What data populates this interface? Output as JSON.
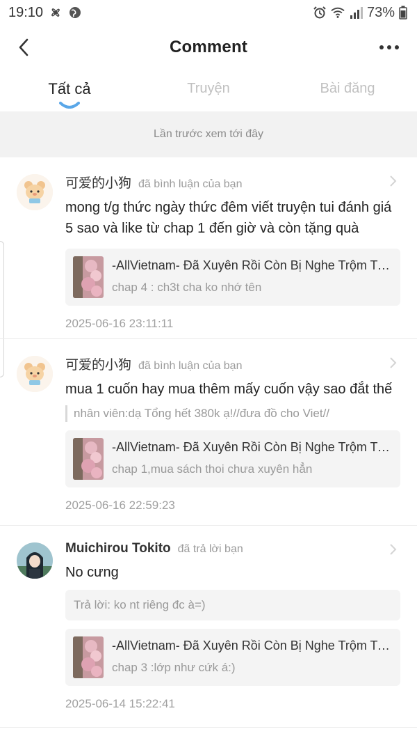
{
  "status_bar": {
    "time": "19:10",
    "battery": "73%"
  },
  "header": {
    "title": "Comment"
  },
  "tabs": [
    {
      "label": "Tất cả",
      "active": true
    },
    {
      "label": "Truyện",
      "active": false
    },
    {
      "label": "Bài đăng",
      "active": false
    }
  ],
  "history_notice": "Lần trước xem tới đây",
  "colors": {
    "accent": "#5aa7e8",
    "background": "#ffffff",
    "muted": "#9a9a9a",
    "card": "#f4f4f4"
  },
  "feed": [
    {
      "user": "可爱的小狗",
      "action": "đã bình luận của bạn",
      "comment": "mong t/g thức ngày thức đêm viết truyện tui đánh giá 5 sao và like từ chap 1 đến giờ và còn tặng quà",
      "ref_title": "-AllVietnam- Đã Xuyên Rồi Còn Bị Nghe Trộm Tiếng Lòng",
      "ref_sub": "chap 4 : ch3t cha ko nhớ tên",
      "time": "2025-06-16 23:11:11"
    },
    {
      "user": "可爱的小狗",
      "action": "đã bình luận của bạn",
      "comment": "mua 1 cuốn hay mua thêm mấy cuốn vậy sao đắt thế",
      "quote": "nhân viên:dạ Tổng hết 380k ạ!//đưa đồ cho Viet//",
      "ref_title": "-AllVietnam- Đã Xuyên Rồi Còn Bị Nghe Trộm Tiếng Lòng",
      "ref_sub": "chap 1,mua sách thoi chưa xuyên hẳn",
      "time": "2025-06-16 22:59:23"
    },
    {
      "user": "Muichirou Tokito",
      "action": "đã trả lời bạn",
      "comment": "No cưng",
      "reply": "Trả lời: ko nt riêng đc à=)",
      "ref_title": "-AllVietnam- Đã Xuyên Rồi Còn Bị Nghe Trộm Tiếng Lòng",
      "ref_sub": "chap 3 :lớp như cứk á:)",
      "time": "2025-06-14 15:22:41"
    }
  ]
}
